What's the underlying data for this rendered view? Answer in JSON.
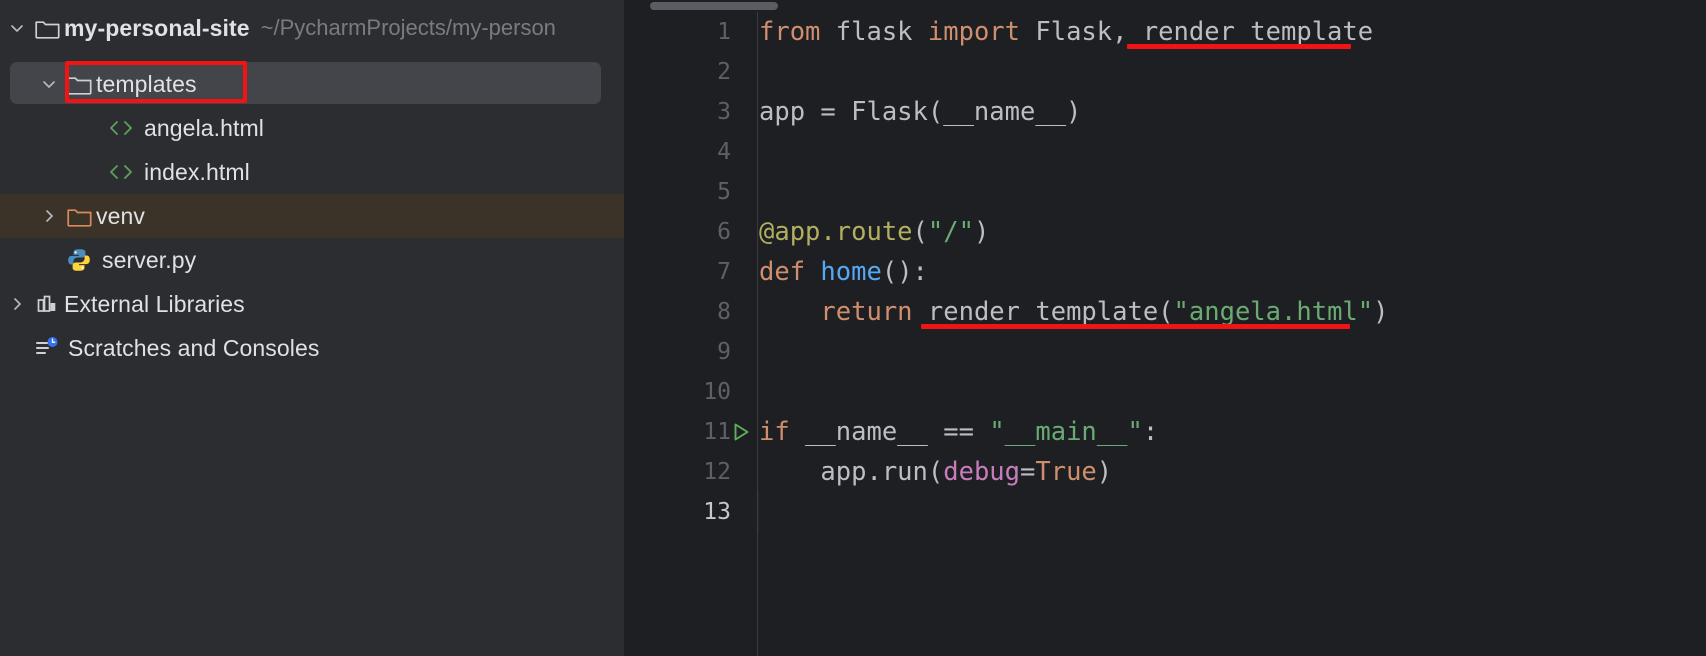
{
  "app": {
    "theme": "dark",
    "accent_red": "#f01414",
    "sidebar_bg": "#2b2d30",
    "editor_bg": "#1e1f22"
  },
  "sidebar": {
    "name": "project-tool-window",
    "items": [
      {
        "label": "my-personal-site",
        "subpath": "~/PycharmProjects/my-person",
        "icon": "folder-icon",
        "twisty": "chevron-down-icon",
        "indent": 0,
        "state": "expanded",
        "bold": true
      },
      {
        "label": "templates",
        "subpath": "",
        "icon": "folder-icon",
        "twisty": "chevron-down-icon",
        "indent": 1,
        "state": "expanded-selected",
        "bold": false
      },
      {
        "label": "angela.html",
        "subpath": "",
        "icon": "html-file-icon",
        "twisty": "",
        "indent": 2,
        "state": "leaf",
        "bold": false
      },
      {
        "label": "index.html",
        "subpath": "",
        "icon": "html-file-icon",
        "twisty": "",
        "indent": 2,
        "state": "leaf",
        "bold": false
      },
      {
        "label": "venv",
        "subpath": "",
        "icon": "folder-excluded-icon",
        "twisty": "chevron-right-icon",
        "indent": 1,
        "state": "collapsed-highlight",
        "bold": false
      },
      {
        "label": "server.py",
        "subpath": "",
        "icon": "python-file-icon",
        "twisty": "",
        "indent": 1,
        "state": "leaf",
        "bold": false
      },
      {
        "label": "External Libraries",
        "subpath": "",
        "icon": "external-libraries-icon",
        "twisty": "chevron-right-icon",
        "indent": 0,
        "state": "collapsed",
        "bold": false
      },
      {
        "label": "Scratches and Consoles",
        "subpath": "",
        "icon": "scratches-icon",
        "twisty": "",
        "indent": 0,
        "state": "leaf",
        "bold": false
      }
    ]
  },
  "editor": {
    "name": "code-editor-server-py",
    "language": "Python",
    "current_line": 13,
    "gutter_run_marker_line": 11,
    "line_numbers": [
      "1",
      "2",
      "3",
      "4",
      "5",
      "6",
      "7",
      "8",
      "9",
      "10",
      "11",
      "12",
      "13"
    ],
    "lines": [
      {
        "n": 1,
        "tokens": [
          {
            "t": "from",
            "c": "kw"
          },
          {
            "t": " flask ",
            "c": "plain"
          },
          {
            "t": "import",
            "c": "kw"
          },
          {
            "t": " Flask, render_template",
            "c": "plain"
          }
        ]
      },
      {
        "n": 2,
        "tokens": []
      },
      {
        "n": 3,
        "tokens": [
          {
            "t": "app = Flask(__name__)",
            "c": "plain"
          }
        ]
      },
      {
        "n": 4,
        "tokens": []
      },
      {
        "n": 5,
        "tokens": []
      },
      {
        "n": 6,
        "tokens": [
          {
            "t": "@app.route",
            "c": "deco"
          },
          {
            "t": "(",
            "c": "plain"
          },
          {
            "t": "\"/\"",
            "c": "str"
          },
          {
            "t": ")",
            "c": "plain"
          }
        ]
      },
      {
        "n": 7,
        "tokens": [
          {
            "t": "def ",
            "c": "kw"
          },
          {
            "t": "home",
            "c": "func"
          },
          {
            "t": "():",
            "c": "plain"
          }
        ]
      },
      {
        "n": 8,
        "tokens": [
          {
            "t": "    return",
            "c": "kw"
          },
          {
            "t": " render_template(",
            "c": "plain"
          },
          {
            "t": "\"angela.html\"",
            "c": "str"
          },
          {
            "t": ")",
            "c": "plain"
          }
        ]
      },
      {
        "n": 9,
        "tokens": []
      },
      {
        "n": 10,
        "tokens": []
      },
      {
        "n": 11,
        "tokens": [
          {
            "t": "if",
            "c": "kw"
          },
          {
            "t": " __name__ == ",
            "c": "plain"
          },
          {
            "t": "\"__main__\"",
            "c": "str"
          },
          {
            "t": ":",
            "c": "plain"
          }
        ]
      },
      {
        "n": 12,
        "tokens": [
          {
            "t": "    app.run(",
            "c": "plain"
          },
          {
            "t": "debug",
            "c": "kwarg"
          },
          {
            "t": "=",
            "c": "plain"
          },
          {
            "t": "True",
            "c": "kw"
          },
          {
            "t": ")",
            "c": "plain"
          }
        ]
      },
      {
        "n": 13,
        "tokens": []
      }
    ],
    "annotations": [
      {
        "name": "red-underline-render-template-import",
        "line": 1,
        "text": "render_template"
      },
      {
        "name": "red-underline-render-template-call",
        "line": 8,
        "text": "render_template(\"angela.html\")"
      }
    ],
    "scrollbar": {
      "name": "horizontal-scrollbar",
      "position": "top"
    }
  },
  "colors": {
    "keyword": "#cf8e6d",
    "string": "#6aab73",
    "decorator": "#b3ae60",
    "function": "#56a8f5",
    "keyword_arg": "#c77dbb",
    "plain_text": "#bcbec4",
    "line_number": "#5d6066",
    "annotation_red": "#f01414",
    "venv_row": "#3b3228",
    "selected_row": "#43454a"
  }
}
